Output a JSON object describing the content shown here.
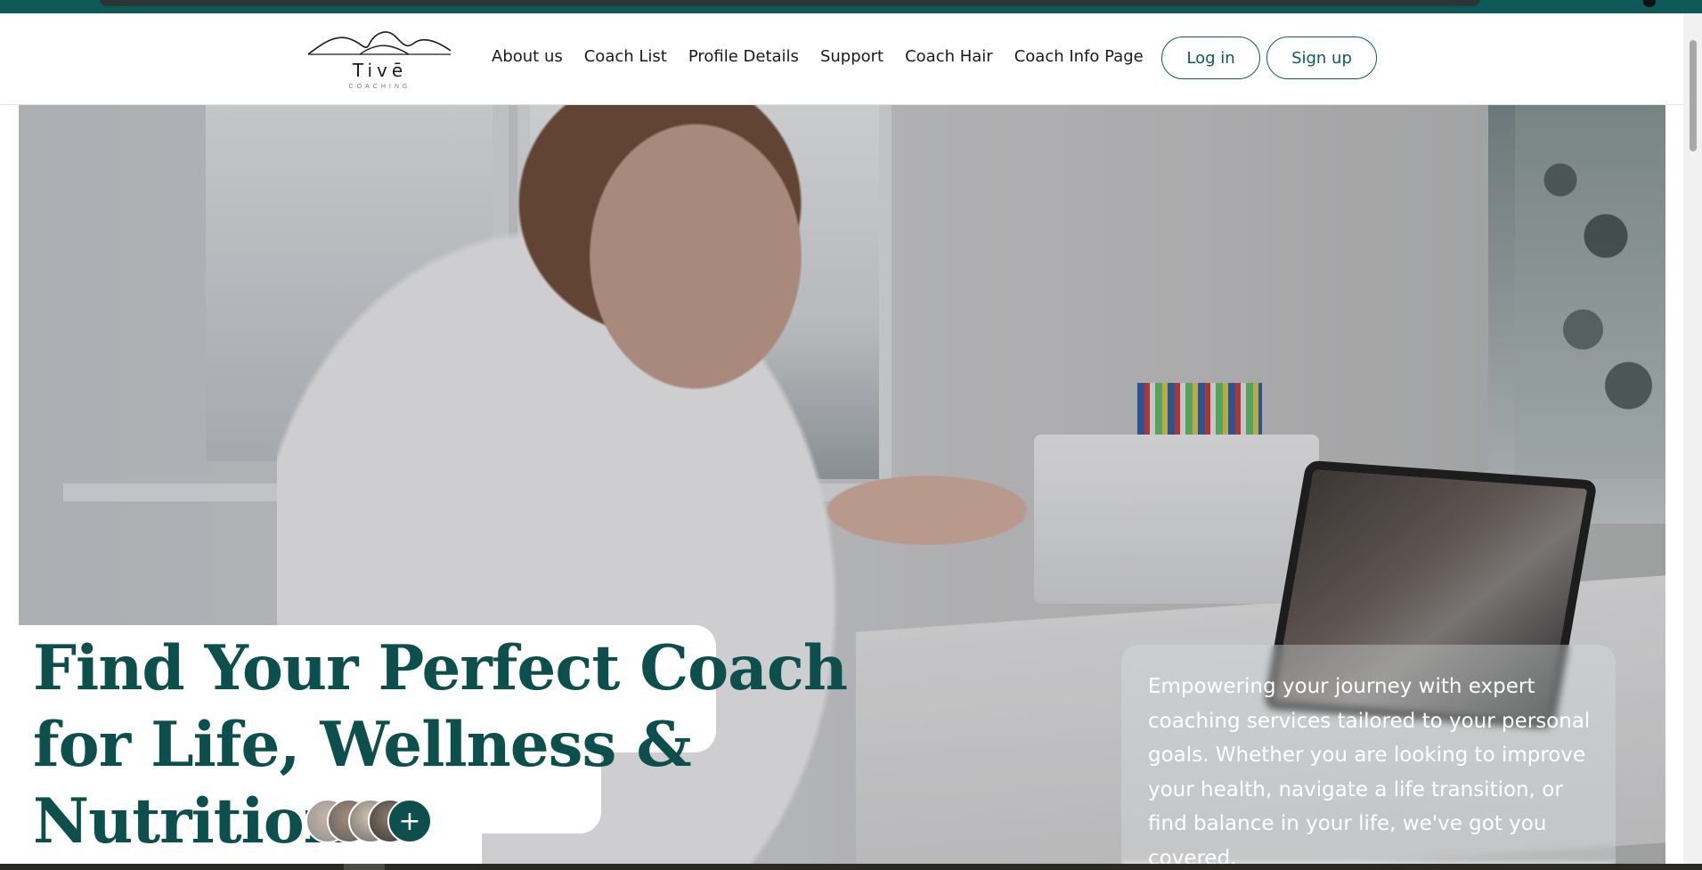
{
  "brand": {
    "name": "Tivē",
    "subtitle": "COACHING"
  },
  "nav": {
    "items": [
      {
        "label": "About us"
      },
      {
        "label": "Coach List"
      },
      {
        "label": "Profile Details"
      },
      {
        "label": "Support"
      },
      {
        "label": "Coach Hair"
      },
      {
        "label": "Coach Info Page"
      }
    ]
  },
  "auth": {
    "login_label": "Log in",
    "signup_label": "Sign up"
  },
  "hero": {
    "headline_line1": "Find Your Perfect Coach",
    "headline_line2": "for Life, Wellness &",
    "headline_line3": "Nutrition",
    "more_coaches_symbol": "+",
    "description": "Empowering your journey with expert coaching services tailored to your personal goals. Whether you are looking to improve your health, navigate a life transition, or find balance in your life, we've got you covered."
  },
  "colors": {
    "brand": "#0c4f4c",
    "accent_bar": "#0e5a59",
    "description_text": "#ffffff"
  },
  "icons": {
    "logo": "mountain-logo-icon",
    "more": "plus-icon"
  }
}
